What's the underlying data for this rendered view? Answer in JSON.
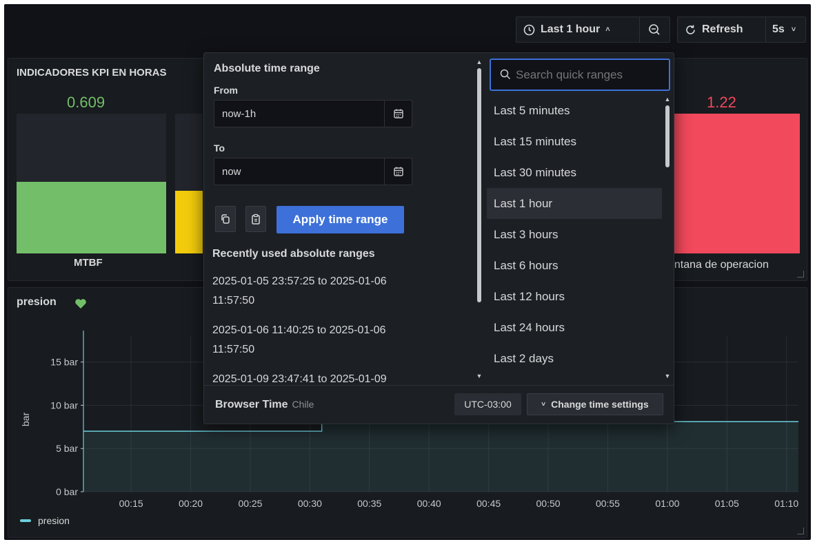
{
  "toolbar": {
    "time_range_label": "Last 1 hour",
    "refresh_label": "Refresh",
    "interval_label": "5s"
  },
  "kpi_panel": {
    "title": "INDICADORES KPI EN HORAS",
    "left": {
      "value": "0.609",
      "name": "MTBF",
      "color": "#73bf69",
      "fill_fraction": 0.51
    },
    "right": {
      "value": "1.22",
      "name": "entana de operacion",
      "color": "#f2495c",
      "fill_fraction": 1.0
    },
    "partial_color": "#f2cc0c"
  },
  "graph_panel": {
    "title": "presion",
    "y_axis_label": "bar",
    "y_ticks": [
      "15 bar",
      "10 bar",
      "5 bar",
      "0 bar"
    ],
    "x_ticks": [
      "00:15",
      "00:20",
      "00:25",
      "00:30",
      "00:35",
      "00:40",
      "00:45",
      "00:50",
      "00:55",
      "01:00",
      "01:05",
      "01:10"
    ],
    "legend": "presion",
    "series_color": "#6ccfdc"
  },
  "chart_data": {
    "type": "line",
    "ylabel": "bar",
    "ylim": [
      0,
      18
    ],
    "x": [
      "00:11",
      "00:15",
      "00:20",
      "00:25",
      "00:30",
      "00:31",
      "00:35",
      "00:40",
      "00:45",
      "00:50",
      "00:55",
      "01:00",
      "01:05",
      "01:10",
      "01:11"
    ],
    "series": [
      {
        "name": "presion",
        "values": [
          7.0,
          7.0,
          7.0,
          7.0,
          7.0,
          8.1,
          8.1,
          8.1,
          8.1,
          8.1,
          8.1,
          8.1,
          8.1,
          8.1,
          8.1
        ]
      }
    ]
  },
  "time_picker": {
    "absolute_title": "Absolute time range",
    "from_label": "From",
    "from_value": "now-1h",
    "to_label": "To",
    "to_value": "now",
    "apply_label": "Apply time range",
    "recent_title": "Recently used absolute ranges",
    "recent": [
      {
        "line1": "2025-01-05 23:57:25 to 2025-01-06",
        "line2": "11:57:50"
      },
      {
        "line1": "2025-01-06 11:40:25 to 2025-01-06",
        "line2": "11:57:50"
      },
      {
        "line1": "2025-01-09 23:47:41 to 2025-01-09",
        "line2": ""
      }
    ],
    "search_placeholder": "Search quick ranges",
    "quick_ranges": [
      "Last 5 minutes",
      "Last 15 minutes",
      "Last 30 minutes",
      "Last 1 hour",
      "Last 3 hours",
      "Last 6 hours",
      "Last 12 hours",
      "Last 24 hours",
      "Last 2 days"
    ],
    "selected_range": "Last 1 hour",
    "footer": {
      "browser_time": "Browser Time",
      "zone": "Chile",
      "utc": "UTC-03:00",
      "change_label": "Change time settings"
    }
  },
  "colors": {
    "accent": "#3d71d9",
    "background": "#111217",
    "panel": "#181b1f"
  }
}
